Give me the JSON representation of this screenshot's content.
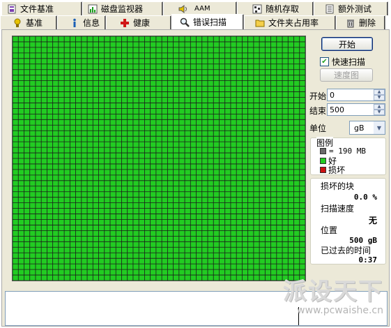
{
  "tabs_row1": [
    {
      "label": "文件基准",
      "icon": "file-benchmark-icon"
    },
    {
      "label": "磁盘监视器",
      "icon": "disk-monitor-icon"
    },
    {
      "label": "AAM",
      "icon": "speaker-icon"
    },
    {
      "label": "随机存取",
      "icon": "random-access-icon"
    },
    {
      "label": "额外测试",
      "icon": "extra-test-icon"
    }
  ],
  "tabs_row2": [
    {
      "label": "基准",
      "icon": "benchmark-icon"
    },
    {
      "label": "信息",
      "icon": "info-icon"
    },
    {
      "label": "健康",
      "icon": "health-cross-icon"
    },
    {
      "label": "错误扫描",
      "icon": "magnifier-icon",
      "active": true
    },
    {
      "label": "文件夹占用率",
      "icon": "folder-icon"
    },
    {
      "label": "删除",
      "icon": "trash-icon"
    }
  ],
  "controls": {
    "start_button": "开始",
    "quick_scan_label": "快速扫描",
    "quick_scan_checked": true,
    "speed_map_button": "速度图",
    "start_label": "开始",
    "start_value": "0",
    "end_label": "结束",
    "end_value": "500",
    "unit_label": "单位",
    "unit_value": "gB"
  },
  "legend": {
    "title": "图例",
    "block_size": "= 190 MB",
    "good": "好",
    "damaged": "损坏"
  },
  "stats": {
    "damaged_blocks_label": "损坏的块",
    "damaged_blocks_value": "0.0 %",
    "scan_speed_label": "扫描速度",
    "scan_speed_value": "无",
    "position_label": "位置",
    "position_value": "500 gB",
    "elapsed_label": "已过去的时间",
    "elapsed_value": "0:37"
  },
  "watermark": {
    "logo_text": "派设天下",
    "url": "www.pcwaishe.cn"
  },
  "colors": {
    "good": "#22cc22",
    "damaged": "#cc1111",
    "grid_line": "#1b1b1b"
  },
  "scan_grid": {
    "cols": 51,
    "rows": 44,
    "status": "all-good"
  }
}
